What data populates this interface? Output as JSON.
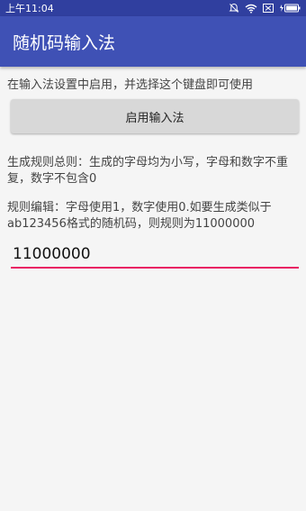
{
  "status_bar": {
    "time": "上午11:04",
    "icons": [
      "alarm-off-icon",
      "wifi-icon",
      "sim-icon",
      "battery-icon"
    ]
  },
  "app_bar": {
    "title": "随机码输入法"
  },
  "main": {
    "enable_hint": "在输入法设置中启用，并选择这个键盘即可使用",
    "enable_button_label": "启用输入法",
    "rule_summary": "生成规则总则：生成的字母均为小写，字母和数字不重复，数字不包含0",
    "rule_edit_hint": "规则编辑：字母使用1，数字使用0.如要生成类似于ab123456格式的随机码，则规则为11000000",
    "rule_input_value": "11000000"
  },
  "colors": {
    "status_bar": "#303f9f",
    "app_bar": "#3f51b5",
    "input_underline": "#e91e63"
  }
}
